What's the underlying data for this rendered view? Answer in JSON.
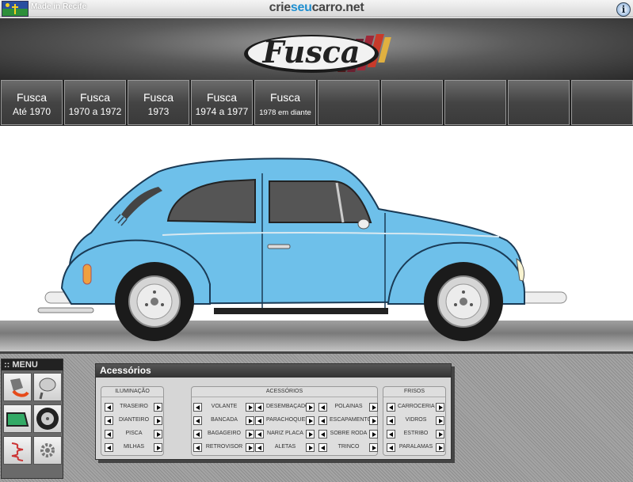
{
  "top_bar": {
    "made_in": "Made in Recife",
    "site_name_left": "crie",
    "site_name_mid": "seu",
    "site_name_right": "carro.net",
    "info_icon": "info-icon"
  },
  "header": {
    "logo_text": "Fusca"
  },
  "tabs": [
    {
      "line1": "Fusca",
      "line2": "Até 1970"
    },
    {
      "line1": "Fusca",
      "line2": "1970 a 1972"
    },
    {
      "line1": "Fusca",
      "line2": "1973"
    },
    {
      "line1": "Fusca",
      "line2": "1974 a 1977"
    },
    {
      "line1": "Fusca",
      "line2": "1978 em diante"
    },
    {
      "line1": "",
      "line2": ""
    },
    {
      "line1": "",
      "line2": ""
    },
    {
      "line1": "",
      "line2": ""
    },
    {
      "line1": "",
      "line2": ""
    },
    {
      "line1": "",
      "line2": ""
    }
  ],
  "car": {
    "body_color": "#6ec0ea",
    "body_shadow": "#3b90c8"
  },
  "menu": {
    "title": ":: MENU",
    "buttons": [
      "paint-bucket-icon",
      "mirror-icon",
      "window-icon",
      "wheel-icon",
      "spring-icon",
      "gear-icon"
    ]
  },
  "accessories": {
    "title": "Acessórios",
    "iluminacao": {
      "title": "ILUMINAÇÃO",
      "items": [
        "TRASEIRO",
        "DIANTEIRO",
        "PISCA",
        "MILHAS"
      ]
    },
    "acessorios": {
      "title": "ACESSÓRIOS",
      "items_left": [
        "VOLANTE",
        "BANCADA",
        "BAGAGEIRO",
        "RETROVISOR"
      ],
      "items_mid": [
        "DESEMBAÇADOR",
        "PARACHOQUES",
        "NARIZ PLACA",
        "ALETAS"
      ],
      "items_right": [
        "POLAINAS",
        "ESCAPAMENTO",
        "SOBRE RODA",
        "TRINCO"
      ]
    },
    "frisos": {
      "title": "FRISOS",
      "items": [
        "CARROCERIA",
        "VIDROS",
        "ESTRIBO",
        "PARALAMAS"
      ]
    }
  }
}
